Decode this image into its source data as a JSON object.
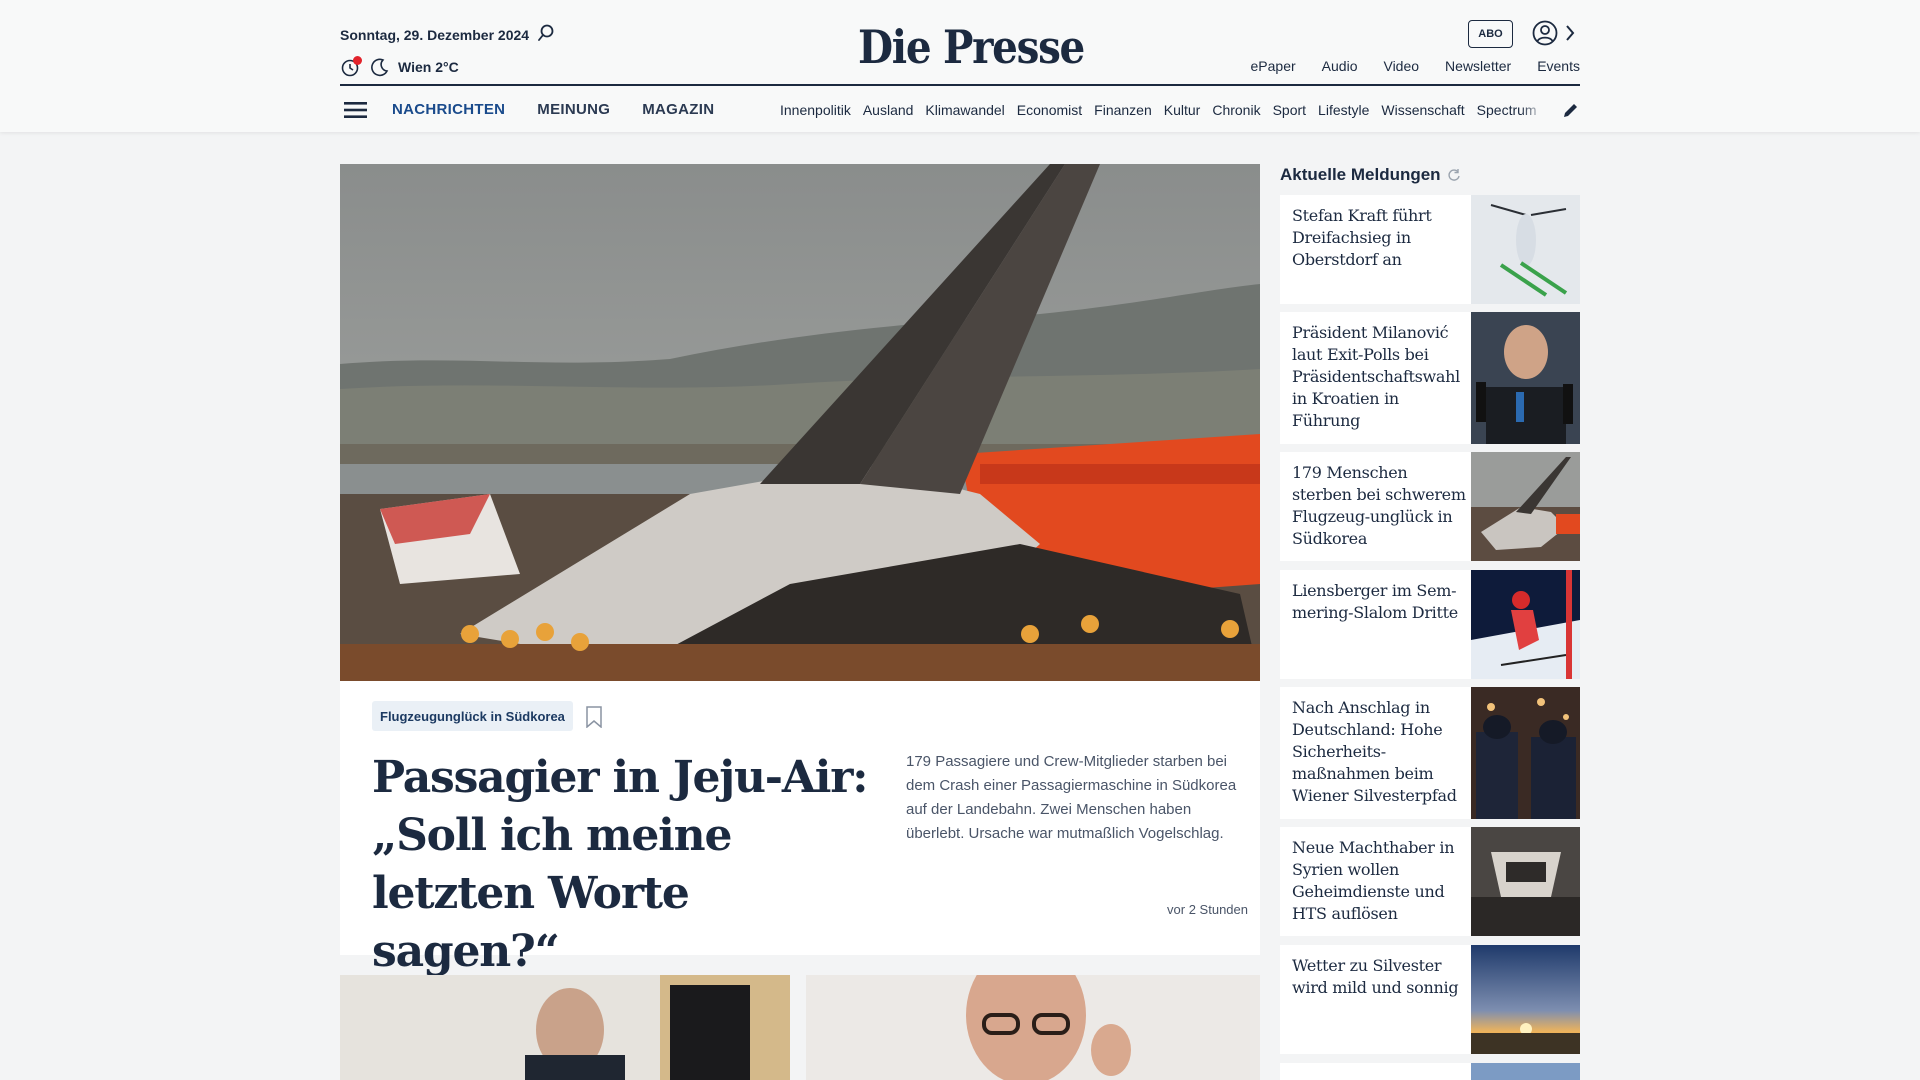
{
  "header": {
    "date": "Sonntag, 29. Dezember 2024",
    "weather": "Wien 2°C",
    "logo": "Die Presse",
    "abo_label": "ABO",
    "top_links": [
      "ePaper",
      "Audio",
      "Video",
      "Newsletter",
      "Events"
    ],
    "main_nav": [
      "NACHRICHTEN",
      "MEINUNG",
      "MAGAZIN"
    ],
    "sub_nav": [
      "Innenpolitik",
      "Ausland",
      "Klimawandel",
      "Economist",
      "Finanzen",
      "Kultur",
      "Chronik",
      "Sport",
      "Lifestyle",
      "Wissenschaft",
      "Spectrum"
    ],
    "icons": [
      "search-icon",
      "theme-icon",
      "moon-icon",
      "user-icon",
      "chevron-right-icon",
      "menu-icon",
      "pen-icon"
    ],
    "accent_color": "#1a4b8c",
    "alert_dot_color": "#e2232b"
  },
  "lead": {
    "tag": "Flugzeugunglück in Südkorea",
    "title": "Passagier in Jeju-Air: „Soll ich meine letzten Worte sagen?“",
    "teaser": "179 Passagiere und Crew-Mitglieder starben bei dem Crash einer Passagiermaschine in Südkorea auf der Landebahn. Zwei Menschen haben überlebt. Ursache war mutmaßlich Vogelschlag.",
    "time": "vor 2 Stunden"
  },
  "sidebar": {
    "title": "Aktuelle Meldungen",
    "items": [
      {
        "text": "Stefan Kraft führt Dreifachsieg in Oberstdorf an"
      },
      {
        "text": "Präsident Milanović laut Exit-Polls bei Präsidentschaftswahl in Kroatien in Führung"
      },
      {
        "text": "179 Menschen sterben bei schwerem Flugzeug-unglück in Südkorea"
      },
      {
        "text": "Liensberger im Sem-mering-Slalom Dritte"
      },
      {
        "text": "Nach Anschlag in Deutschland: Hohe Sicherheits-maßnahmen beim Wiener Silvesterpfad"
      },
      {
        "text": "Neue Machthaber in Syrien wollen Geheimdienste und HTS auflösen"
      },
      {
        "text": "Wetter zu Silvester wird mild und sonnig"
      }
    ]
  }
}
